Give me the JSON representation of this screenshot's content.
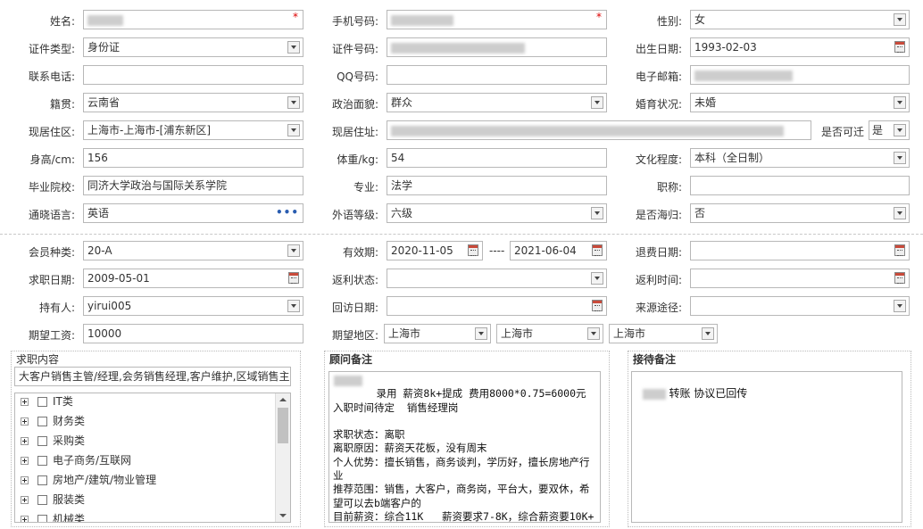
{
  "form": {
    "name": {
      "label": "姓名:"
    },
    "mobile": {
      "label": "手机号码:"
    },
    "gender": {
      "label": "性别:",
      "value": "女"
    },
    "id_type": {
      "label": "证件类型:",
      "value": "身份证"
    },
    "id_no": {
      "label": "证件号码:"
    },
    "birth_date": {
      "label": "出生日期:",
      "value": "1993-02-03"
    },
    "phone": {
      "label": "联系电话:",
      "value": ""
    },
    "qq": {
      "label": "QQ号码:",
      "value": ""
    },
    "email": {
      "label": "电子邮箱:"
    },
    "native_place": {
      "label": "籍贯:",
      "value": "云南省"
    },
    "political": {
      "label": "政治面貌:",
      "value": "群众"
    },
    "marital": {
      "label": "婚育状况:",
      "value": "未婚"
    },
    "residence_area": {
      "label": "现居住区:",
      "value": "上海市-上海市-[浦东新区]"
    },
    "residence_addr": {
      "label": "现居住址:"
    },
    "relocate": {
      "label": "是否可迁",
      "value": "是"
    },
    "height": {
      "label": "身高/cm:",
      "value": "156"
    },
    "weight": {
      "label": "体重/kg:",
      "value": "54"
    },
    "education": {
      "label": "文化程度:",
      "value": "本科（全日制）"
    },
    "school": {
      "label": "毕业院校:",
      "value": "同济大学政治与国际关系学院"
    },
    "major": {
      "label": "专业:",
      "value": "法学"
    },
    "title": {
      "label": "职称:",
      "value": ""
    },
    "language": {
      "label": "通晓语言:",
      "value": "英语"
    },
    "lang_level": {
      "label": "外语等级:",
      "value": "六级"
    },
    "overseas": {
      "label": "是否海归:",
      "value": "否"
    }
  },
  "member": {
    "type": {
      "label": "会员种类:",
      "value": "20-A"
    },
    "validity": {
      "label": "有效期:",
      "from": "2020-11-05",
      "sep": "----",
      "to": "2021-06-04"
    },
    "refund_date": {
      "label": "退费日期:",
      "value": ""
    },
    "job_date": {
      "label": "求职日期:",
      "value": "2009-05-01"
    },
    "rebate_status": {
      "label": "返利状态:",
      "value": ""
    },
    "rebate_time": {
      "label": "返利时间:",
      "value": ""
    },
    "holder": {
      "label": "持有人:",
      "value": "yirui005"
    },
    "visit_date": {
      "label": "回访日期:",
      "value": ""
    },
    "source": {
      "label": "来源途径:",
      "value": ""
    },
    "salary": {
      "label": "期望工资:",
      "value": "10000"
    },
    "region": {
      "label": "期望地区:",
      "v1": "上海市",
      "v2": "上海市",
      "v3": "上海市"
    }
  },
  "job_content": {
    "title": "求职内容",
    "summary": "大客户销售主管/经理,会务销售经理,客户维护,区域销售主管",
    "tree": [
      "IT类",
      "财务类",
      "采购类",
      "电子商务/互联网",
      "房地产/建筑/物业管理",
      "服装类",
      "机械类"
    ]
  },
  "advisor_notes": {
    "title": "顾问备注",
    "text": "     录用 薪资8k+提成 费用8000*0.75=6000元\n入职时间待定  销售经理岗\n\n求职状态：离职\n离职原因：薪资天花板，没有周末\n个人优势：擅长销售，商务谈判，学历好，擅长房地产行业\n推荐范围：销售，大客户，商务岗，平台大，要双休，希望可以去b端客户的\n目前薪资：综合11K   薪资要求7-8K，综合薪资要10K+"
  },
  "reception_notes": {
    "title": "接待备注",
    "text": "转账 协议已回传"
  },
  "icons": {
    "dropdown": "chevron-down-icon",
    "calendar": "calendar-icon",
    "more": "ellipsis-icon",
    "expand": "plus-box-icon"
  },
  "colors": {
    "required": "#dd0000",
    "border": "#b8b8b8",
    "accent": "#2a5db0"
  }
}
